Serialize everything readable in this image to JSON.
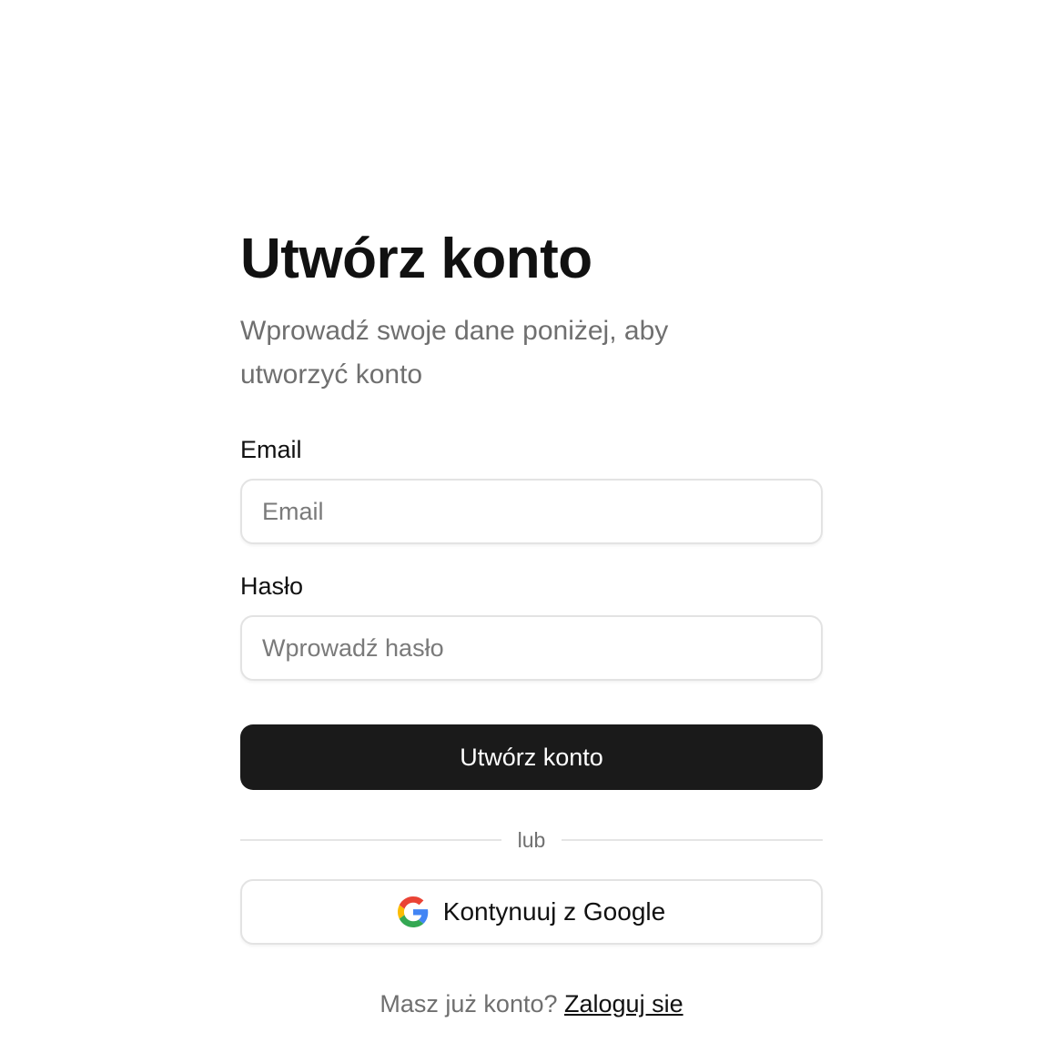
{
  "form": {
    "title": "Utwórz konto",
    "subtitle": "Wprowadź swoje dane poniżej, aby utworzyć konto",
    "email_label": "Email",
    "email_placeholder": "Email",
    "email_value": "",
    "password_label": "Hasło",
    "password_placeholder": "Wprowadź hasło",
    "password_value": "",
    "submit_label": "Utwórz konto",
    "divider_text": "lub",
    "google_label": "Kontynuuj z Google",
    "google_icon": "google-icon",
    "footer_text": "Masz już konto?",
    "footer_link": "Zaloguj sie"
  },
  "colors": {
    "primary_button": "#1a1a1a",
    "subtitle_text": "#6f6f6f",
    "border": "#e3e3e3"
  }
}
